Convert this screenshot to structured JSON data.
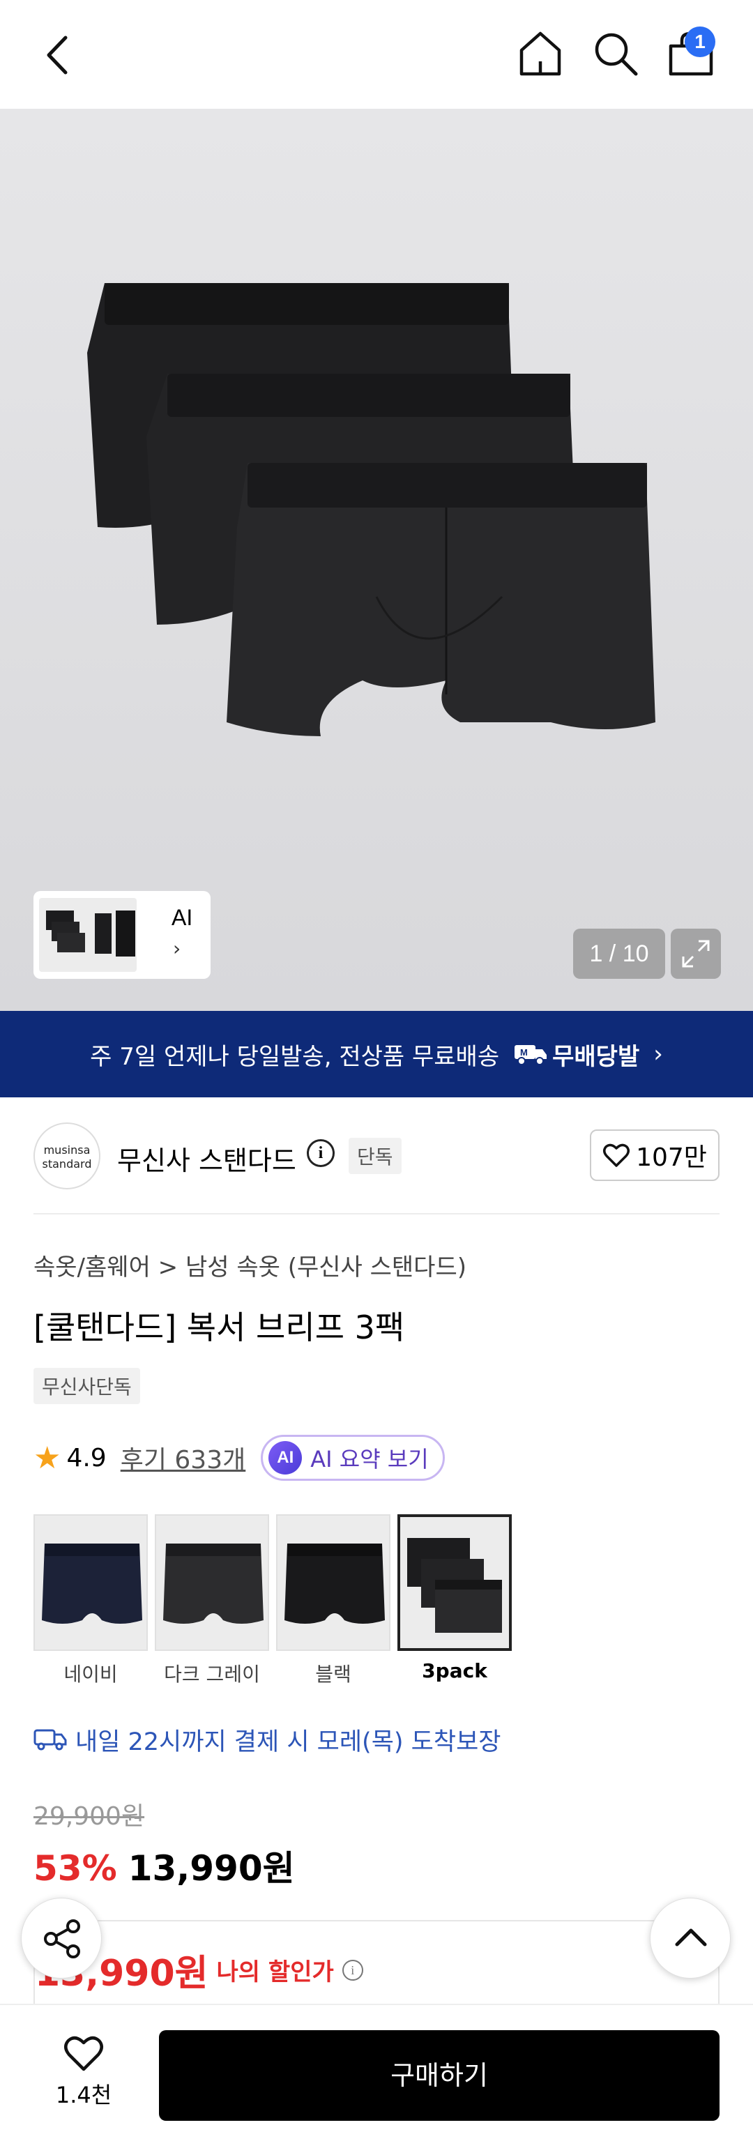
{
  "header": {
    "cart_count": "1",
    "icons": [
      "back-arrow-icon",
      "home-icon",
      "search-icon",
      "shopping-bag-icon"
    ]
  },
  "gallery": {
    "thumbnail_label": "AI",
    "thumbnail_chevron": "›",
    "counter": "1 / 10"
  },
  "banner": {
    "text": "주 7일 언제나 당일발송, 전상품 무료배송",
    "logo_text": "무배당발",
    "chevron": "›"
  },
  "brand": {
    "logo_line1": "musinsa",
    "logo_line2": "standard",
    "name": "무신사 스탠다드",
    "info_glyph": "i",
    "tag": "단독",
    "likes": "107만"
  },
  "product": {
    "breadcrumb": "속옷/홈웨어 > 남성 속옷 (무신사 스탠다드)",
    "title": "[쿨탠다드] 복서 브리프 3팩",
    "exclusive_badge": "무신사단독",
    "rating": "4.9",
    "reviews": "후기 633개",
    "ai_icon": "AI",
    "ai_summary": "AI 요약 보기"
  },
  "swatches": [
    {
      "label": "네이비",
      "color": "#1c2238"
    },
    {
      "label": "다크 그레이",
      "color": "#2a2a2c"
    },
    {
      "label": "블랙",
      "color": "#18181a"
    },
    {
      "label": "3pack",
      "color": "#1e1e20"
    }
  ],
  "delivery": {
    "text": "내일 22시까지 결제 시 모레(목) 도착보장"
  },
  "price": {
    "original": "29,900원",
    "discount_pct": "53%",
    "sale": "13,990원",
    "my_price": "13,990원",
    "my_price_label": "나의 할인가",
    "info_glyph": "i"
  },
  "bottom": {
    "wish_count": "1.4천",
    "buy_label": "구매하기"
  },
  "colors": {
    "banner_bg": "#0e2a78",
    "sale_red": "#e42b2b",
    "delivery_blue": "#2c55b7",
    "badge_blue": "#2a6df4"
  }
}
